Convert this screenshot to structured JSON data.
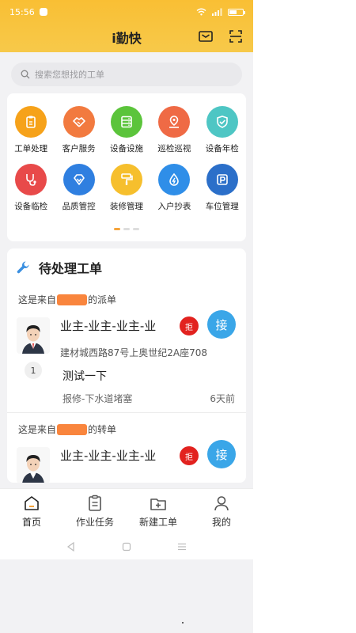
{
  "status_bar": {
    "time": "15:56",
    "battery_level": 0.55
  },
  "header": {
    "title": "i勤快"
  },
  "search": {
    "placeholder": "搜索您想找的工单"
  },
  "grid": [
    {
      "label": "工单处理",
      "icon": "clipboard-icon",
      "color": "#f6a21a"
    },
    {
      "label": "客户服务",
      "icon": "handshake-icon",
      "color": "#f27a3f"
    },
    {
      "label": "设备设施",
      "icon": "server-icon",
      "color": "#5bc43b"
    },
    {
      "label": "巡检巡视",
      "icon": "location-pin-icon",
      "color": "#ef6a45"
    },
    {
      "label": "设备年检",
      "icon": "shield-check-icon",
      "color": "#4ec6c4"
    },
    {
      "label": "设备临检",
      "icon": "stethoscope-icon",
      "color": "#e84a4a"
    },
    {
      "label": "品质管控",
      "icon": "diamond-icon",
      "color": "#2f7fe0"
    },
    {
      "label": "装修管理",
      "icon": "paint-roller-icon",
      "color": "#f6bf2d"
    },
    {
      "label": "入户抄表",
      "icon": "water-drop-icon",
      "color": "#2f8ee8"
    },
    {
      "label": "车位管理",
      "icon": "parking-icon",
      "color": "#2b6fc9"
    }
  ],
  "pending": {
    "title": "待处理工单",
    "orders": [
      {
        "source_prefix": "这是来自",
        "source_suffix": "的派单",
        "name": "业主-业主-业主-业",
        "address": "建材城西路87号上奥世纪2A座708",
        "description": "测试一下",
        "type": "报修-下水道堵塞",
        "time": "6天前",
        "count": "1",
        "reject_label": "拒",
        "accept_label": "接"
      },
      {
        "source_prefix": "这是来自",
        "source_suffix": "的转单",
        "name": "业主-业主-业主-业",
        "reject_label": "拒",
        "accept_label": "接"
      }
    ]
  },
  "tabbar": [
    {
      "label": "首页",
      "icon": "home-icon",
      "active": true
    },
    {
      "label": "作业任务",
      "icon": "task-list-icon"
    },
    {
      "label": "新建工单",
      "icon": "new-order-icon"
    },
    {
      "label": "我的",
      "icon": "profile-icon"
    }
  ],
  "colors": {
    "header": "#f9bf34",
    "accent_orange": "#f5a43b",
    "accept_blue": "#3aa6e8",
    "reject_red": "#e2221f"
  }
}
